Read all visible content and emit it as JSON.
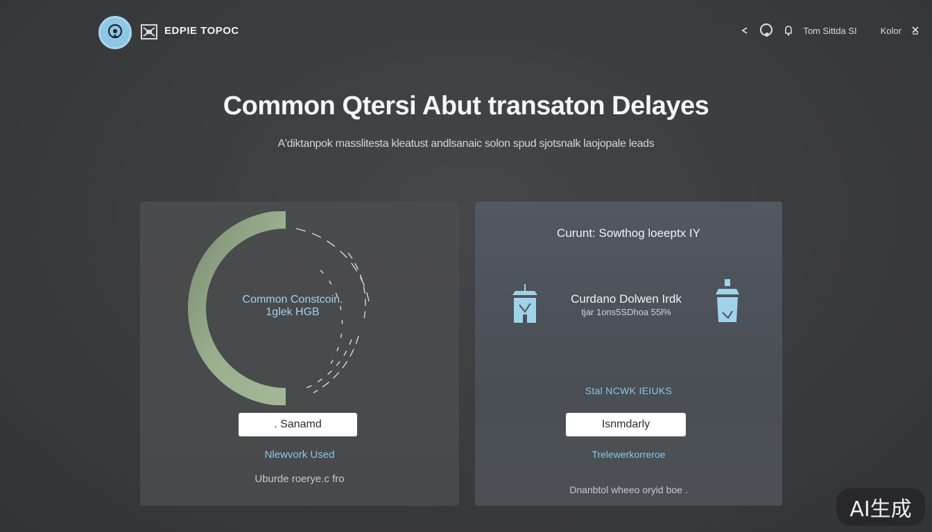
{
  "header": {
    "brand_name": "EDPIE TOPOC",
    "nav": {
      "link_1": "Tom Sittda SI",
      "link_2": "Kolor"
    },
    "icons": [
      "arrow-icon",
      "user-icon",
      "bell-icon",
      "close-icon"
    ]
  },
  "hero": {
    "title": "Common Qtersi Abut transaton Delayes",
    "subtitle": "A'diktanpok masslitesta kleatust andlsanaic solon spud sjotsnalk laojopale leads"
  },
  "card_left": {
    "ring_label_1": "Common Constcoin.",
    "ring_label_2": "1glek HGB",
    "ring_fraction": 0.5,
    "ring_color": "#9bb08f",
    "button_label": ". Sanamd",
    "accent_link": "Nlewvork Used",
    "footer_text": "Uburde roerye.c fro"
  },
  "card_right": {
    "title": "Curunt: Sowthog loeeptx IY",
    "stat_label": "Curdano Dolwen Irdk",
    "stat_value": "tjar 1ons5SDhoa 55l%",
    "section_tag": "Stal NCWK IEIUKS",
    "button_label": "Isnmdarly",
    "accent_link": "Trelewerkorreroe",
    "footer_text": "Dnanbtol wheeo oryid boe ."
  },
  "watermark": {
    "text": "AI生成"
  },
  "colors": {
    "accent": "#8ec6e4",
    "ring_green": "#9bb08f",
    "background": "#3a3b3d"
  }
}
